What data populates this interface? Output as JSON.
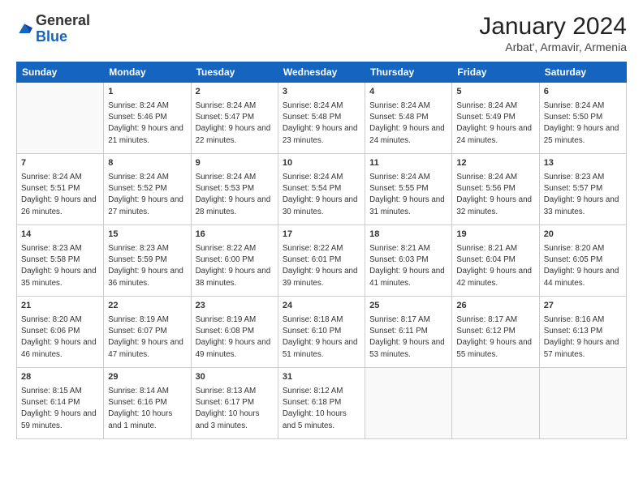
{
  "logo": {
    "general": "General",
    "blue": "Blue"
  },
  "header": {
    "month": "January 2024",
    "location": "Arbat', Armavir, Armenia"
  },
  "weekdays": [
    "Sunday",
    "Monday",
    "Tuesday",
    "Wednesday",
    "Thursday",
    "Friday",
    "Saturday"
  ],
  "weeks": [
    [
      {
        "day": "",
        "sunrise": "",
        "sunset": "",
        "daylight": ""
      },
      {
        "day": "1",
        "sunrise": "Sunrise: 8:24 AM",
        "sunset": "Sunset: 5:46 PM",
        "daylight": "Daylight: 9 hours and 21 minutes."
      },
      {
        "day": "2",
        "sunrise": "Sunrise: 8:24 AM",
        "sunset": "Sunset: 5:47 PM",
        "daylight": "Daylight: 9 hours and 22 minutes."
      },
      {
        "day": "3",
        "sunrise": "Sunrise: 8:24 AM",
        "sunset": "Sunset: 5:48 PM",
        "daylight": "Daylight: 9 hours and 23 minutes."
      },
      {
        "day": "4",
        "sunrise": "Sunrise: 8:24 AM",
        "sunset": "Sunset: 5:48 PM",
        "daylight": "Daylight: 9 hours and 24 minutes."
      },
      {
        "day": "5",
        "sunrise": "Sunrise: 8:24 AM",
        "sunset": "Sunset: 5:49 PM",
        "daylight": "Daylight: 9 hours and 24 minutes."
      },
      {
        "day": "6",
        "sunrise": "Sunrise: 8:24 AM",
        "sunset": "Sunset: 5:50 PM",
        "daylight": "Daylight: 9 hours and 25 minutes."
      }
    ],
    [
      {
        "day": "7",
        "sunrise": "Sunrise: 8:24 AM",
        "sunset": "Sunset: 5:51 PM",
        "daylight": "Daylight: 9 hours and 26 minutes."
      },
      {
        "day": "8",
        "sunrise": "Sunrise: 8:24 AM",
        "sunset": "Sunset: 5:52 PM",
        "daylight": "Daylight: 9 hours and 27 minutes."
      },
      {
        "day": "9",
        "sunrise": "Sunrise: 8:24 AM",
        "sunset": "Sunset: 5:53 PM",
        "daylight": "Daylight: 9 hours and 28 minutes."
      },
      {
        "day": "10",
        "sunrise": "Sunrise: 8:24 AM",
        "sunset": "Sunset: 5:54 PM",
        "daylight": "Daylight: 9 hours and 30 minutes."
      },
      {
        "day": "11",
        "sunrise": "Sunrise: 8:24 AM",
        "sunset": "Sunset: 5:55 PM",
        "daylight": "Daylight: 9 hours and 31 minutes."
      },
      {
        "day": "12",
        "sunrise": "Sunrise: 8:24 AM",
        "sunset": "Sunset: 5:56 PM",
        "daylight": "Daylight: 9 hours and 32 minutes."
      },
      {
        "day": "13",
        "sunrise": "Sunrise: 8:23 AM",
        "sunset": "Sunset: 5:57 PM",
        "daylight": "Daylight: 9 hours and 33 minutes."
      }
    ],
    [
      {
        "day": "14",
        "sunrise": "Sunrise: 8:23 AM",
        "sunset": "Sunset: 5:58 PM",
        "daylight": "Daylight: 9 hours and 35 minutes."
      },
      {
        "day": "15",
        "sunrise": "Sunrise: 8:23 AM",
        "sunset": "Sunset: 5:59 PM",
        "daylight": "Daylight: 9 hours and 36 minutes."
      },
      {
        "day": "16",
        "sunrise": "Sunrise: 8:22 AM",
        "sunset": "Sunset: 6:00 PM",
        "daylight": "Daylight: 9 hours and 38 minutes."
      },
      {
        "day": "17",
        "sunrise": "Sunrise: 8:22 AM",
        "sunset": "Sunset: 6:01 PM",
        "daylight": "Daylight: 9 hours and 39 minutes."
      },
      {
        "day": "18",
        "sunrise": "Sunrise: 8:21 AM",
        "sunset": "Sunset: 6:03 PM",
        "daylight": "Daylight: 9 hours and 41 minutes."
      },
      {
        "day": "19",
        "sunrise": "Sunrise: 8:21 AM",
        "sunset": "Sunset: 6:04 PM",
        "daylight": "Daylight: 9 hours and 42 minutes."
      },
      {
        "day": "20",
        "sunrise": "Sunrise: 8:20 AM",
        "sunset": "Sunset: 6:05 PM",
        "daylight": "Daylight: 9 hours and 44 minutes."
      }
    ],
    [
      {
        "day": "21",
        "sunrise": "Sunrise: 8:20 AM",
        "sunset": "Sunset: 6:06 PM",
        "daylight": "Daylight: 9 hours and 46 minutes."
      },
      {
        "day": "22",
        "sunrise": "Sunrise: 8:19 AM",
        "sunset": "Sunset: 6:07 PM",
        "daylight": "Daylight: 9 hours and 47 minutes."
      },
      {
        "day": "23",
        "sunrise": "Sunrise: 8:19 AM",
        "sunset": "Sunset: 6:08 PM",
        "daylight": "Daylight: 9 hours and 49 minutes."
      },
      {
        "day": "24",
        "sunrise": "Sunrise: 8:18 AM",
        "sunset": "Sunset: 6:10 PM",
        "daylight": "Daylight: 9 hours and 51 minutes."
      },
      {
        "day": "25",
        "sunrise": "Sunrise: 8:17 AM",
        "sunset": "Sunset: 6:11 PM",
        "daylight": "Daylight: 9 hours and 53 minutes."
      },
      {
        "day": "26",
        "sunrise": "Sunrise: 8:17 AM",
        "sunset": "Sunset: 6:12 PM",
        "daylight": "Daylight: 9 hours and 55 minutes."
      },
      {
        "day": "27",
        "sunrise": "Sunrise: 8:16 AM",
        "sunset": "Sunset: 6:13 PM",
        "daylight": "Daylight: 9 hours and 57 minutes."
      }
    ],
    [
      {
        "day": "28",
        "sunrise": "Sunrise: 8:15 AM",
        "sunset": "Sunset: 6:14 PM",
        "daylight": "Daylight: 9 hours and 59 minutes."
      },
      {
        "day": "29",
        "sunrise": "Sunrise: 8:14 AM",
        "sunset": "Sunset: 6:16 PM",
        "daylight": "Daylight: 10 hours and 1 minute."
      },
      {
        "day": "30",
        "sunrise": "Sunrise: 8:13 AM",
        "sunset": "Sunset: 6:17 PM",
        "daylight": "Daylight: 10 hours and 3 minutes."
      },
      {
        "day": "31",
        "sunrise": "Sunrise: 8:12 AM",
        "sunset": "Sunset: 6:18 PM",
        "daylight": "Daylight: 10 hours and 5 minutes."
      },
      {
        "day": "",
        "sunrise": "",
        "sunset": "",
        "daylight": ""
      },
      {
        "day": "",
        "sunrise": "",
        "sunset": "",
        "daylight": ""
      },
      {
        "day": "",
        "sunrise": "",
        "sunset": "",
        "daylight": ""
      }
    ]
  ]
}
